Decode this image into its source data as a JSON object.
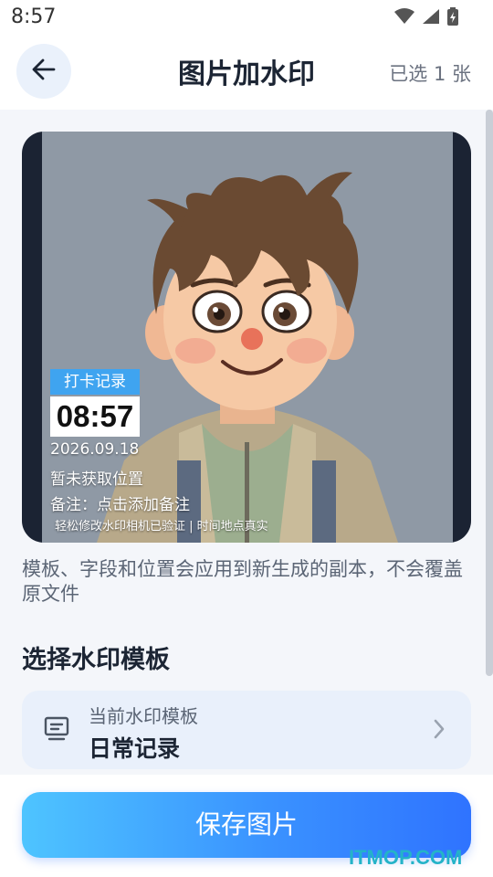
{
  "status_bar": {
    "time": "8:57",
    "icons": [
      "wifi-icon",
      "signal-icon",
      "battery-icon"
    ]
  },
  "header": {
    "back_icon": "arrow-left-icon",
    "title": "图片加水印",
    "selected_count": "已选 1 张"
  },
  "preview": {
    "image": "cartoon-boy-portrait",
    "watermark": {
      "tag": "打卡记录",
      "time": "08:57",
      "date": "2026.09.18",
      "location": "暂未获取位置",
      "note": "备注：点击添加备注",
      "footer": "轻松修改水印相机已验证 | 时间地点真实"
    }
  },
  "notice": "模板、字段和位置会应用到新生成的副本，不会覆盖原文件",
  "template_section": {
    "title": "选择水印模板",
    "current_label": "当前水印模板",
    "current_name": "日常记录",
    "icon": "template-icon",
    "chevron_icon": "chevron-right-icon"
  },
  "save_button": "保存图片",
  "brand_watermark": "ITMOP.COM",
  "colors": {
    "accent": "#3a92ff",
    "accent_light": "#4ec4ff",
    "watermark_tag": "#3fa4f0",
    "card_bg": "#e9f0fb",
    "page_bg": "#f4f6fa"
  }
}
